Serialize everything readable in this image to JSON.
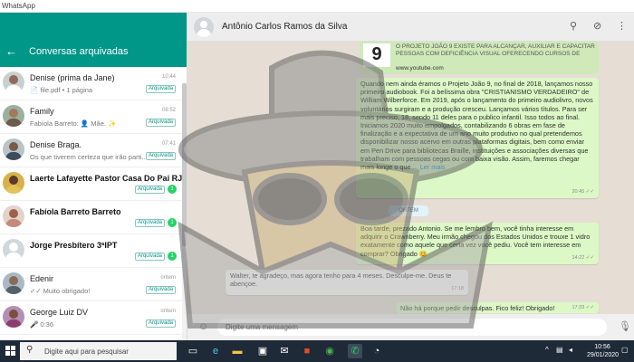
{
  "window": {
    "title": "WhatsApp"
  },
  "sidebar": {
    "title": "Conversas arquivadas",
    "chats": [
      {
        "name": "Denise (prima da Jane)",
        "preview": "📄 file.pdf • 1 página",
        "time": "10:44",
        "badge": "Arquivada",
        "unread": ""
      },
      {
        "name": "Family",
        "preview": "Fabíola Barreto: 👤 Mãe. ✨",
        "time": "08:52",
        "badge": "Arquivada",
        "unread": ""
      },
      {
        "name": "Denise Braga.",
        "preview": "Os que tiverem certeza que irão parti...",
        "time": "07:41",
        "badge": "Arquivada",
        "unread": ""
      },
      {
        "name": "Laerte Lafayette Pastor Casa Do Pai RJ",
        "preview": "",
        "time": "",
        "badge": "Arquivada",
        "unread": "1"
      },
      {
        "name": "Fabíola Barreto Barreto",
        "preview": "",
        "time": "",
        "badge": "Arquivada",
        "unread": "1"
      },
      {
        "name": "Jorge Presbítero 3ªIPT",
        "preview": "",
        "time": "",
        "badge": "Arquivada",
        "unread": "1"
      },
      {
        "name": "Edenir",
        "preview": "✓✓ Muito obrigado!",
        "time": "ontem",
        "badge": "Arquivada",
        "unread": ""
      },
      {
        "name": "George Luiz DV",
        "preview": "🎤 0:36",
        "time": "ontem",
        "badge": "Arquivada",
        "unread": ""
      }
    ]
  },
  "conversation": {
    "contact_name": "Antônio Carlos Ramos da Silva",
    "link_preview": {
      "thumb": "9",
      "text": "O PROJETO JOÃO 9 EXISTE PARA ALCANÇAR, AUXILIAR E CAPACITAR PESSOAS COM DEFICIÊNCIA VISUAL OFERECENDO CURSOS DE",
      "url": "www.youtube.com"
    },
    "messages": [
      {
        "body": "Quando nem ainda éramos o Projeto João 9, no final de 2018, lançamos nosso primeiro audiobook. Foi a belíssima obra \"CRISTIANISMO VERDADEIRO\" de William Wilberforce. Em 2019, após  o lançamento do primeiro audiolivro, novos voluntários surgiram e a produção cresceu. Lançamos vários títulos. Para ser mais preciso, 18,  sendo 11 deles para o publico infantil. Isso todos ao final. Iniciamos 2020 muito empolgados, contabilizando 6 obras em fase de finalização e a expectativa de um ano muito produtivo no qual pretendemos disponibilizar nosso acervo em outras plataformas digitais, bem como enviar em Pen Drive  para bibliotecas Braille, instituições e associações diversas que trabalham com pessoas cegas ou com baixa visão. Assim, faremos chegar mais longe o que",
        "more": "... Ler mais",
        "time": "20:45 ✓✓"
      },
      {
        "body": "Boa tarde, prezado Antonio. Se me lembro bem, você tinha interesse em adquirir o Crawnberry. Meu irmão  chegou dos Estados Unidos e trouxe 1 vidro exatamente como aquele que certa vez você pediu. Você tem interesse em comprar?  Obrigado 😊",
        "time": "14:22 ✓✓"
      },
      {
        "body": "Walter, te agradeço, mas agora tenho para 4 meses. Desculpe-me. Deus te abençoe.",
        "time": "17:18"
      },
      {
        "body": "Não há porque pedir desculpas. Fico feliz! Obrigado!",
        "time": "17:33 ✓✓"
      }
    ],
    "date_chip": "ONTEM",
    "composer_placeholder": "Digite uma mensagem"
  },
  "taskbar": {
    "search_placeholder": "Digite aqui para pesquisar",
    "clock_time": "10:56",
    "clock_date": "29/01/2020"
  },
  "colors": {
    "accent": "#009688",
    "outgoing_bubble": "#dcf8c6",
    "chat_bg": "#e6ded4",
    "taskbar": "#1f2a38"
  }
}
